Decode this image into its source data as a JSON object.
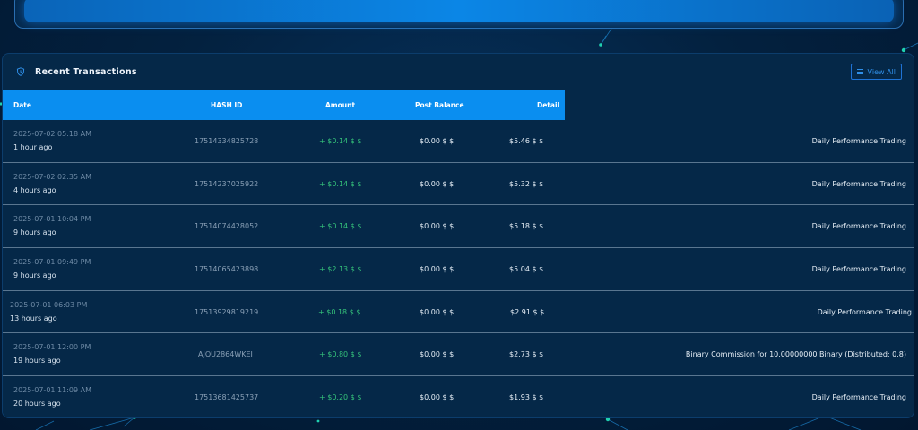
{
  "card": {
    "title": "Recent Transactions",
    "view_all_label": "View All"
  },
  "table": {
    "headers": [
      "Date",
      "HASH ID",
      "Amount",
      "Post Balance",
      "Detail"
    ],
    "rows": [
      {
        "date": "2025-07-02 05:18 AM",
        "ago": "1 hour ago",
        "hash": "17514334825728",
        "amount": "+ $0.14 $ $",
        "post": "$0.00 $ $",
        "balance": "$5.46 $ $",
        "detail": "Daily Performance Trading"
      },
      {
        "date": "2025-07-02 02:35 AM",
        "ago": "4 hours ago",
        "hash": "17514237025922",
        "amount": "+ $0.14 $ $",
        "post": "$0.00 $ $",
        "balance": "$5.32 $ $",
        "detail": "Daily Performance Trading"
      },
      {
        "date": "2025-07-01 10:04 PM",
        "ago": "9 hours ago",
        "hash": "17514074428052",
        "amount": "+ $0.14 $ $",
        "post": "$0.00 $ $",
        "balance": "$5.18 $ $",
        "detail": "Daily Performance Trading"
      },
      {
        "date": "2025-07-01 09:49 PM",
        "ago": "9 hours ago",
        "hash": "17514065423898",
        "amount": "+ $2.13 $ $",
        "post": "$0.00 $ $",
        "balance": "$5.04 $ $",
        "detail": "Daily Performance Trading"
      },
      {
        "date": "2025-07-01 06:03 PM",
        "ago": "13 hours ago",
        "hash": "17513929819219",
        "amount": "+ $0.18 $ $",
        "post": "$0.00 $ $",
        "balance": "$2.91 $ $",
        "detail": "Daily Performance Trading"
      },
      {
        "date": "2025-07-01 12:00 PM",
        "ago": "19 hours ago",
        "hash": "AJQU2864WKEI",
        "amount": "+ $0.80 $ $",
        "post": "$0.00 $ $",
        "balance": "$2.73 $ $",
        "detail": "Binary Commission for 10.00000000 Binary (Distributed: 0.8)"
      },
      {
        "date": "2025-07-01 11:09 AM",
        "ago": "20 hours ago",
        "hash": "17513681425737",
        "amount": "+ $0.20 $ $",
        "post": "$0.00 $ $",
        "balance": "$1.93 $ $",
        "detail": "Daily Performance Trading"
      }
    ]
  },
  "colors": {
    "accent": "#0a8ef0",
    "positive": "#35c27a",
    "background": "#021a33"
  },
  "icons": {
    "card_icon": "shield-clock-icon",
    "view_all_icon": "list-lines-icon"
  }
}
